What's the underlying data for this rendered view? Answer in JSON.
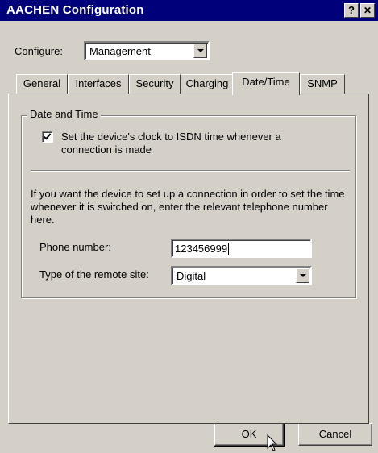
{
  "window": {
    "title": "AACHEN Configuration",
    "help_label": "?",
    "close_label": "✕"
  },
  "configure": {
    "label": "Configure:",
    "value": "Management"
  },
  "tabs": [
    {
      "label": "General",
      "active": false
    },
    {
      "label": "Interfaces",
      "active": false
    },
    {
      "label": "Security",
      "active": false
    },
    {
      "label": "Charging",
      "active": false
    },
    {
      "label": "Date/Time",
      "active": true
    },
    {
      "label": "SNMP",
      "active": false
    }
  ],
  "datetime": {
    "group_title": "Date and Time",
    "isdn_checkbox": {
      "checked": true,
      "label": "Set the device's clock to ISDN time whenever a connection is made"
    },
    "info": "If you want the device to set up a connection in order to set the time whenever it is switched on, enter the relevant telephone number here.",
    "phone_label": "Phone number:",
    "phone_value": "123456999",
    "remote_label": "Type of the remote site:",
    "remote_value": "Digital"
  },
  "buttons": {
    "ok": "OK",
    "cancel": "Cancel"
  },
  "icons": {
    "help": "help-icon",
    "close": "close-icon",
    "cursor": "mouse-pointer-icon"
  },
  "colors": {
    "titlebar": "#00007b",
    "face": "#d4d0c8"
  }
}
